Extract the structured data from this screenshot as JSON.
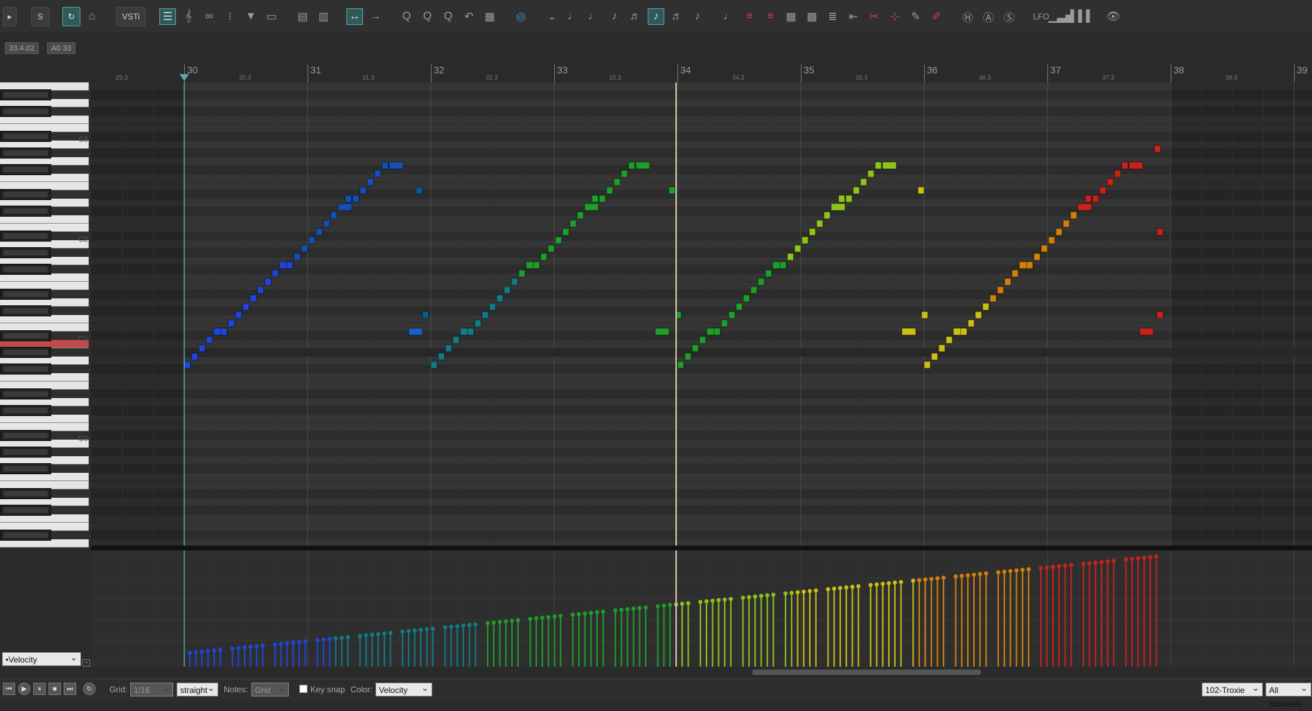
{
  "toolbar": {
    "solo_label": "S",
    "vsti_label": "VSTi",
    "lfo_label": "LFO"
  },
  "readouts": {
    "position": "33.4.02",
    "note": "A0  33"
  },
  "ruler": {
    "bars": [
      "30",
      "31",
      "32",
      "33",
      "34",
      "35",
      "36",
      "37",
      "38",
      "39"
    ],
    "half_bars": [
      "29.3",
      "30.3",
      "31.3",
      "32.3",
      "33.3",
      "34.3",
      "35.3",
      "36.3",
      "37.3",
      "38.3"
    ]
  },
  "piano": {
    "octave_labels": [
      "C3",
      "C2",
      "C1",
      "C0"
    ]
  },
  "lane": {
    "selected": "•Velocity"
  },
  "bottom": {
    "grid_label": "Grid:",
    "grid_value": "1/16",
    "swing_value": "straight",
    "notes_label": "Notes:",
    "notes_value": "Grid",
    "keysnap_label": "Key snap",
    "color_label": "Color:",
    "color_value": "Velocity",
    "instrument_value": "102-Troxie",
    "channels_value": "All channels"
  },
  "colors": {
    "blue": "#1f46d6",
    "teal": "#137a86",
    "green": "#1e9e2b",
    "lime": "#8ec31c",
    "yellow": "#cbbe14",
    "orange": "#d1800c",
    "red": "#c7231b",
    "playhead": "#d8c7a8",
    "cursor": "#54a9a3"
  },
  "notes": [
    {
      "bar": "30",
      "pitch_row": 34,
      "color": "blue"
    },
    {
      "bar": "30",
      "pitch_row": 33,
      "color": "blue"
    },
    {
      "bar": "30",
      "pitch_row": 32,
      "color": "blue"
    },
    {
      "bar": "30",
      "pitch_row": 31,
      "color": "blue"
    },
    {
      "bar": "30",
      "pitch_row": 30,
      "color": "blue"
    },
    {
      "bar": "31",
      "pitch_row": 10,
      "color": "blue"
    },
    {
      "bar": "31",
      "pitch_row": 13,
      "color": "blue"
    },
    {
      "bar": "31",
      "pitch_row": 29,
      "color": "blue"
    },
    {
      "bar": "31",
      "pitch_row": 27,
      "color": "blue"
    },
    {
      "bar": "32",
      "pitch_row": 34,
      "color": "teal"
    },
    {
      "bar": "32",
      "pitch_row": 30,
      "color": "teal"
    },
    {
      "bar": "33",
      "pitch_row": 10,
      "color": "green"
    },
    {
      "bar": "33",
      "pitch_row": 31,
      "color": "green"
    },
    {
      "bar": "34",
      "pitch_row": 34,
      "color": "lime"
    },
    {
      "bar": "35",
      "pitch_row": 10,
      "color": "yellow"
    },
    {
      "bar": "36",
      "pitch_row": 34,
      "color": "orange"
    },
    {
      "bar": "37",
      "pitch_row": 8,
      "color": "red"
    }
  ]
}
